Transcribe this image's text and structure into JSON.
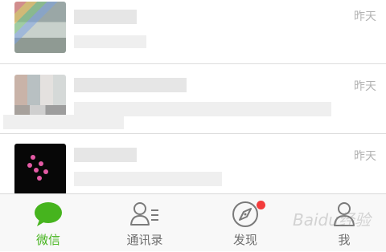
{
  "chats": [
    {
      "time": "昨天"
    },
    {
      "time": "昨天"
    },
    {
      "time": "昨天"
    }
  ],
  "tabs": [
    {
      "label": "微信",
      "icon": "chat-bubble-icon",
      "active": true
    },
    {
      "label": "通讯录",
      "icon": "contacts-icon",
      "active": false
    },
    {
      "label": "发现",
      "icon": "compass-icon",
      "active": false,
      "badge": true
    },
    {
      "label": "我",
      "icon": "person-icon",
      "active": false
    }
  ],
  "colors": {
    "accent": "#46b41e",
    "badge": "#f33c3c"
  },
  "watermark": "Baidu经验"
}
